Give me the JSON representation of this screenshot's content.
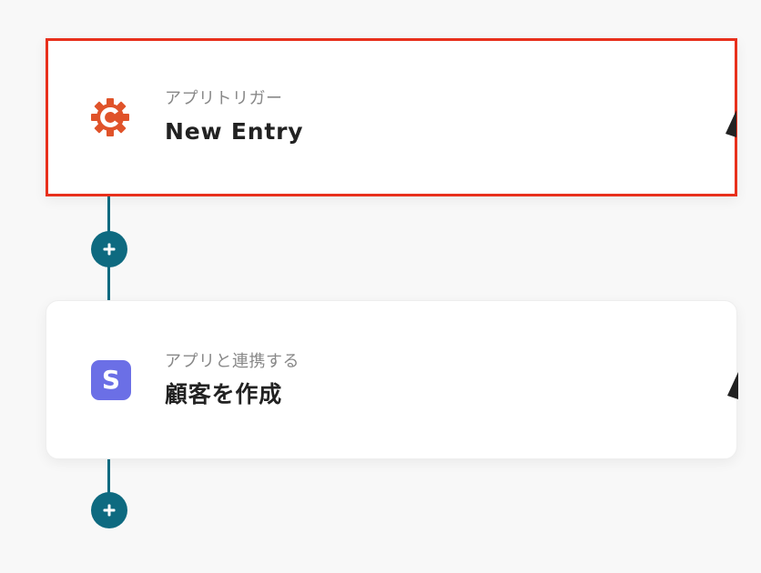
{
  "flow": {
    "steps": [
      {
        "sub_label": "アプリトリガー",
        "title": "New Entry",
        "icon": "cognito-gear-icon",
        "icon_color": "#e0532a",
        "selected": true
      },
      {
        "sub_label": "アプリと連携する",
        "title": "顧客を作成",
        "icon": "stripe-icon",
        "icon_letter": "S",
        "icon_color": "#6b6fe6",
        "selected": false
      }
    ],
    "add_icon": "plus-icon"
  },
  "colors": {
    "connector": "#0e6a80",
    "selected_border": "#e8301c",
    "background": "#f8f8f8"
  }
}
